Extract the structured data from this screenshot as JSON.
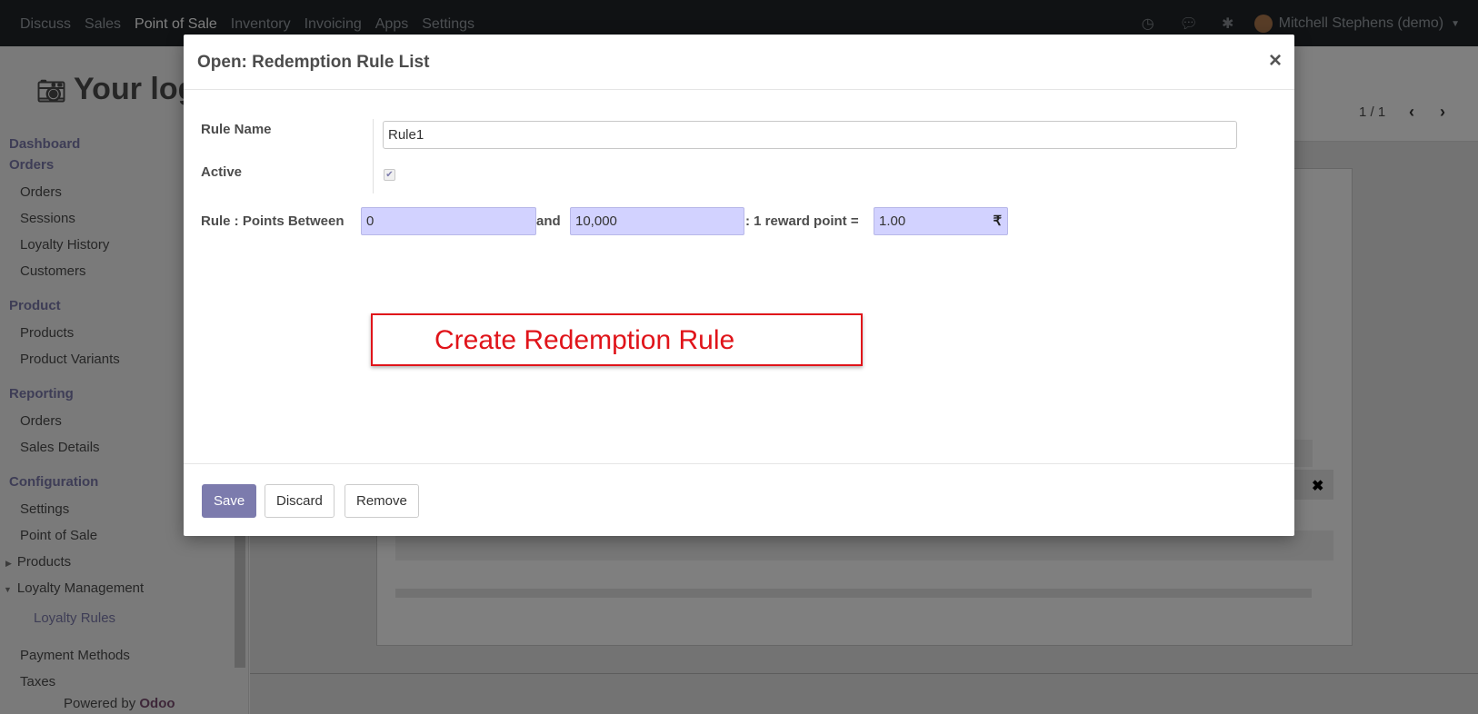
{
  "topmenu": {
    "items": [
      "Discuss",
      "Sales",
      "Point of Sale",
      "Inventory",
      "Invoicing",
      "Apps",
      "Settings"
    ],
    "active_item": "Point of Sale",
    "user_name": "Mitchell Stephens (demo)",
    "icons": [
      "clock-icon",
      "chat-icon",
      "bug-icon"
    ]
  },
  "sidebar": {
    "logo_text": "Your log",
    "sections": [
      {
        "title": "Dashboard"
      },
      {
        "title": "Orders",
        "items": [
          "Orders",
          "Sessions",
          "Loyalty History",
          "Customers"
        ]
      },
      {
        "title": "Product",
        "items": [
          "Products",
          "Product Variants"
        ]
      },
      {
        "title": "Reporting",
        "items": [
          "Orders",
          "Sales Details"
        ]
      },
      {
        "title": "Configuration",
        "items": [
          "Settings",
          "Point of Sale",
          "Products",
          "Loyalty Management",
          "Loyalty Rules",
          "Payment Methods",
          "Taxes"
        ]
      }
    ],
    "powered_by": "Powered by",
    "powered_brand": "Odoo"
  },
  "pager": {
    "text": "1 / 1"
  },
  "modal": {
    "title": "Open: Redemption Rule List",
    "close_symbol": "×",
    "rule_name_label": "Rule Name",
    "rule_name_value": "Rule1",
    "active_label": "Active",
    "active_checked": true,
    "points_between_label": "Rule : Points Between",
    "points_from": "0",
    "and_label": "and",
    "points_to": "10,000",
    "reward_label": ": 1 reward point =",
    "reward_value": "1.00",
    "currency_symbol": "₹",
    "annotation_text": "Create Redemption Rule",
    "buttons": {
      "save": "Save",
      "discard": "Discard",
      "remove": "Remove"
    }
  },
  "colors": {
    "navbar": "#212529",
    "accent": "#7c7bad",
    "highlight_field": "#d2d2ff",
    "annotation_red": "#e0141a"
  }
}
